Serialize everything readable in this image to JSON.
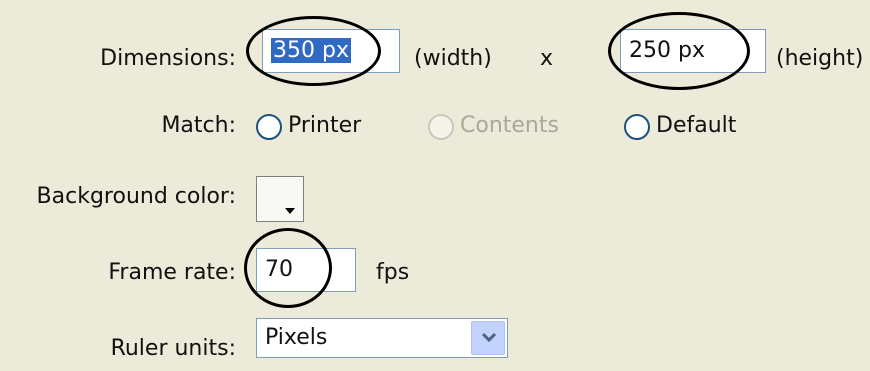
{
  "dimensions": {
    "label": "Dimensions:",
    "width_value": "350 px",
    "width_caption": "(width)",
    "times": "x",
    "height_value": "250 px",
    "height_caption": "(height)"
  },
  "match": {
    "label": "Match:",
    "options": [
      "Printer",
      "Contents",
      "Default"
    ]
  },
  "background": {
    "label": "Background color:",
    "swatch_color": "#f8f8f4"
  },
  "frame_rate": {
    "label": "Frame rate:",
    "value": "70",
    "unit": "fps"
  },
  "ruler": {
    "label": "Ruler units:",
    "value": "Pixels"
  },
  "colors": {
    "background": "#ecead9",
    "selection": "#316ac5",
    "field_border": "#7f9db9"
  }
}
